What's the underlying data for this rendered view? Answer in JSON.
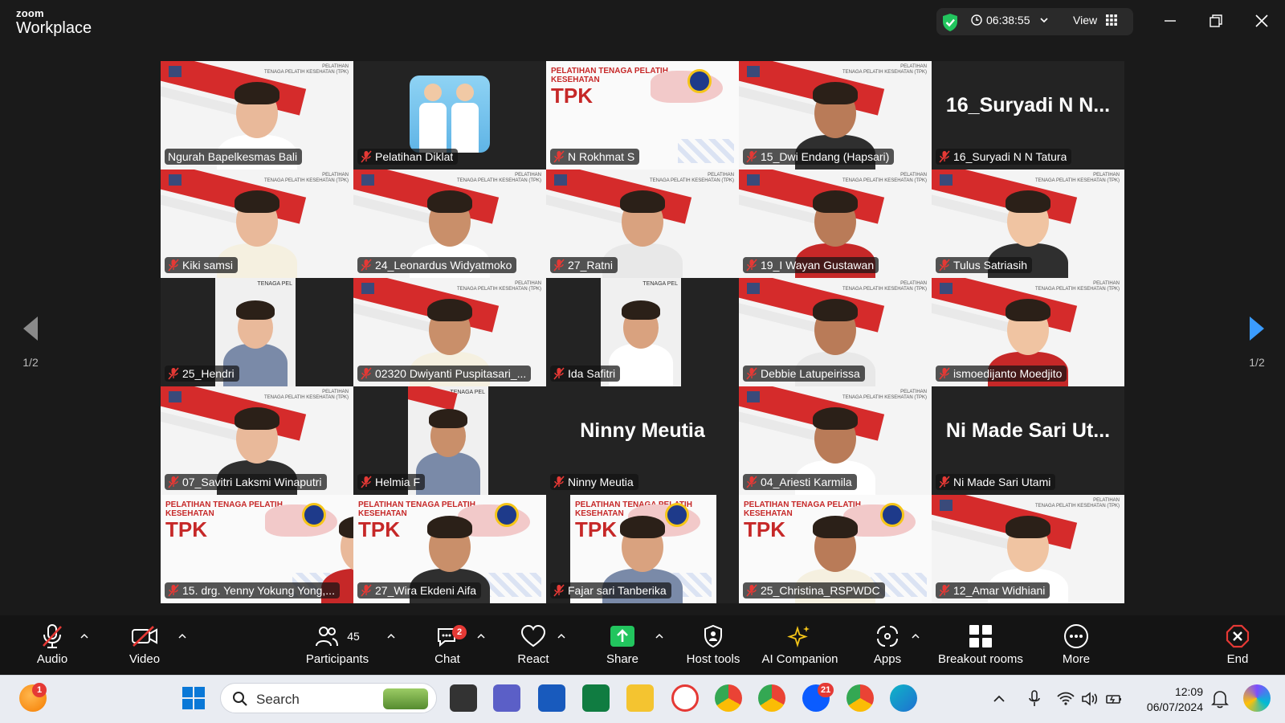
{
  "app": {
    "brand_line1": "zoom",
    "brand_line2": "Workplace"
  },
  "header": {
    "timer": "06:38:55",
    "view_label": "View"
  },
  "pager": {
    "left": "1/2",
    "right": "1/2"
  },
  "participants_grid": {
    "tiles": [
      {
        "name": "Ngurah Bapelkesmas Bali",
        "muted": false,
        "active": true,
        "bg": "banner"
      },
      {
        "name": "Pelatihan Diklat",
        "muted": true,
        "bg": "dark-doctors"
      },
      {
        "name": "N Rokhmat S",
        "muted": true,
        "bg": "tpk"
      },
      {
        "name": "15_Dwi Endang (Hapsari)",
        "muted": true,
        "bg": "banner"
      },
      {
        "name": "16_Suryadi N N Tatura",
        "muted": true,
        "bg": "name",
        "display_name": "16_Suryadi N N..."
      },
      {
        "name": "Kiki samsi",
        "muted": true,
        "bg": "banner"
      },
      {
        "name": "24_Leonardus Widyatmoko",
        "muted": true,
        "bg": "banner"
      },
      {
        "name": "27_Ratni",
        "muted": true,
        "bg": "banner"
      },
      {
        "name": "19_I Wayan Gustawan",
        "muted": true,
        "bg": "banner"
      },
      {
        "name": "Tulus Satriasih",
        "muted": true,
        "bg": "banner"
      },
      {
        "name": "25_Hendri",
        "muted": true,
        "bg": "narrow"
      },
      {
        "name": "02320 Dwiyanti Puspitasari_...",
        "muted": true,
        "bg": "banner"
      },
      {
        "name": "Ida Safitri",
        "muted": true,
        "bg": "narrow"
      },
      {
        "name": "Debbie Latupeirissa",
        "muted": true,
        "bg": "banner"
      },
      {
        "name": "ismoedijanto Moedjito",
        "muted": true,
        "bg": "banner"
      },
      {
        "name": "07_Savitri Laksmi Winaputri",
        "muted": true,
        "bg": "banner"
      },
      {
        "name": "Helmia F",
        "muted": true,
        "bg": "narrow"
      },
      {
        "name": "Ninny Meutia",
        "muted": true,
        "bg": "name",
        "display_name": "Ninny Meutia"
      },
      {
        "name": "04_Ariesti Karmila",
        "muted": true,
        "bg": "banner"
      },
      {
        "name": "Ni Made Sari Utami",
        "muted": true,
        "bg": "name",
        "display_name": "Ni Made Sari Ut..."
      },
      {
        "name": "15. drg. Yenny Yokung Yong,...",
        "muted": true,
        "bg": "tpk"
      },
      {
        "name": "27_Wira Ekdeni Aifa",
        "muted": true,
        "bg": "tpk"
      },
      {
        "name": "Fajar sari Tanberika",
        "muted": true,
        "bg": "tpk-narrow"
      },
      {
        "name": "25_Christina_RSPWDC",
        "muted": true,
        "bg": "tpk"
      },
      {
        "name": "12_Amar Widhiani",
        "muted": true,
        "bg": "banner"
      }
    ]
  },
  "banner_text": {
    "corner_line1": "PELATIHAN",
    "corner_line2": "TENAGA PELATIH KESEHATAN (TPK)",
    "tpk_line1": "PELATIHAN TENAGA PELATIH",
    "tpk_line2": "KESEHATAN",
    "tpk_big": "TPK",
    "narrow_text": "TENAGA PEL"
  },
  "toolbar": {
    "audio": "Audio",
    "video": "Video",
    "participants": "Participants",
    "participants_count": "45",
    "chat": "Chat",
    "chat_badge": "2",
    "react": "React",
    "share": "Share",
    "host_tools": "Host tools",
    "ai_companion": "AI Companion",
    "apps": "Apps",
    "breakout_rooms": "Breakout rooms",
    "more": "More",
    "end": "End"
  },
  "taskbar": {
    "search_placeholder": "Search",
    "weather_badge": "1",
    "zoom_badge": "21",
    "time": "12:09",
    "date": "06/07/2024"
  },
  "colors": {
    "active_speaker": "#22c55e",
    "share_green": "#22c55e",
    "end_red": "#e53935",
    "pager_blue": "#3b9cff",
    "banner_red": "#d52b2b"
  }
}
